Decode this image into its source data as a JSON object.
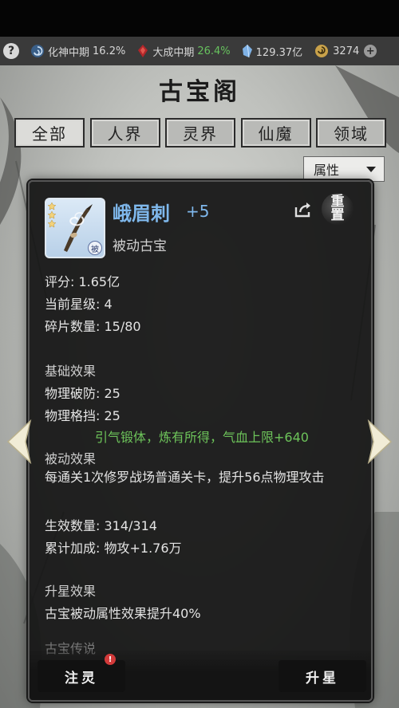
{
  "resources": [
    {
      "icon": "swirl-icon",
      "label": "化神中期",
      "value": "16.2%",
      "highlight": false
    },
    {
      "icon": "red-emblem-icon",
      "label": "大成中期",
      "value": "26.4%",
      "highlight": true
    },
    {
      "icon": "spirit-stone-icon",
      "label": "",
      "value": "129.37亿",
      "highlight": false
    },
    {
      "icon": "coin-icon",
      "label": "",
      "value": "3274",
      "highlight": false
    }
  ],
  "title": "古宝阁",
  "tabs": [
    {
      "label": "全部",
      "active": true
    },
    {
      "label": "人界",
      "active": false
    },
    {
      "label": "灵界",
      "active": false
    },
    {
      "label": "仙魔",
      "active": false
    },
    {
      "label": "领域",
      "active": false
    }
  ],
  "filter": {
    "selected": "属性"
  },
  "item": {
    "name": "峨眉刺",
    "level": "+5",
    "type": "被动古宝",
    "tag": "被",
    "stars": 3,
    "reset_label": [
      "重",
      "置"
    ]
  },
  "stats": {
    "score": "评分: 1.65亿",
    "current_star": "当前星级: 4",
    "fragments": "碎片数量: 15/80"
  },
  "basic": {
    "heading": "基础效果",
    "lines": [
      "物理破防: 25",
      "物理格挡: 25"
    ]
  },
  "bonus_line": "引气锻体，炼有所得，气血上限+640",
  "passive": {
    "heading": "被动效果",
    "description": "每通关1次修罗战场普通关卡，提升56点物理攻击",
    "effective": "生效数量: 314/314",
    "cumulative": "累计加成: 物攻+1.76万"
  },
  "starup": {
    "heading": "升星效果",
    "text": "古宝被动属性效果提升40%"
  },
  "partial_heading": "古宝传说",
  "buttons": {
    "infuse": "注灵",
    "starup": "升星",
    "badge": "!"
  },
  "colors": {
    "item_name": "#7fb8ec",
    "bonus": "#6dc45a",
    "resource_highlight": "#67c25e"
  }
}
